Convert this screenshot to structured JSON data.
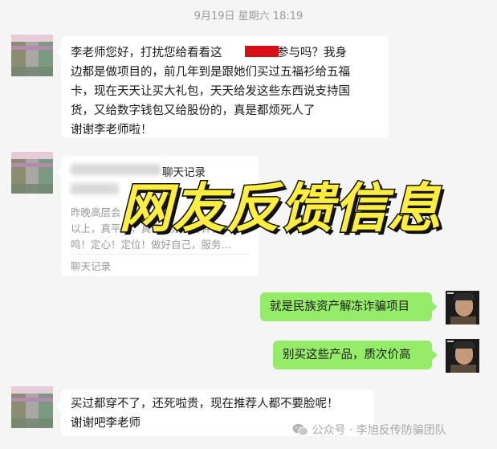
{
  "timestamp": "9月19日 星期六 18:19",
  "messages": {
    "m1": {
      "line1": "李老师您好，打扰您给看看这",
      "line1_end": "能参与吗？我身",
      "line2": "边都是做项目的，前几年到是跟她们买过五福衫给五福",
      "line3": "卡，现在天天让买大礼包，天天给发这些东西说支持国",
      "line4": "货，又给数字钱包又给股份的，真是都烦死人了",
      "line5": "谢谢李老师啦！"
    },
    "card": {
      "title": "聊天记录",
      "line1": "昨晚高层会",
      "line2": "以上，真平台，真事真办，客钟长",
      "line3": "鸣！定心！定位！做好自己，服务...",
      "footer": "聊天记录"
    },
    "m3": {
      "text": "就是民族资产解冻诈骗项目"
    },
    "m4": {
      "text": "别买这些产品，质次价高"
    },
    "m5": {
      "line1": "买过都穿不了，还死啦贵，现在推荐人都不要脸呢！",
      "line2": "谢谢吧李老师"
    }
  },
  "overlay": {
    "title": "网友反馈信息"
  },
  "watermark": {
    "icon": "wechat-icon",
    "text": "公众号 · 李旭反传防骗团队"
  },
  "colors": {
    "green_bubble": "#95ec69",
    "redact": "#d80f16",
    "overlay_fill": "#ffee3a"
  }
}
